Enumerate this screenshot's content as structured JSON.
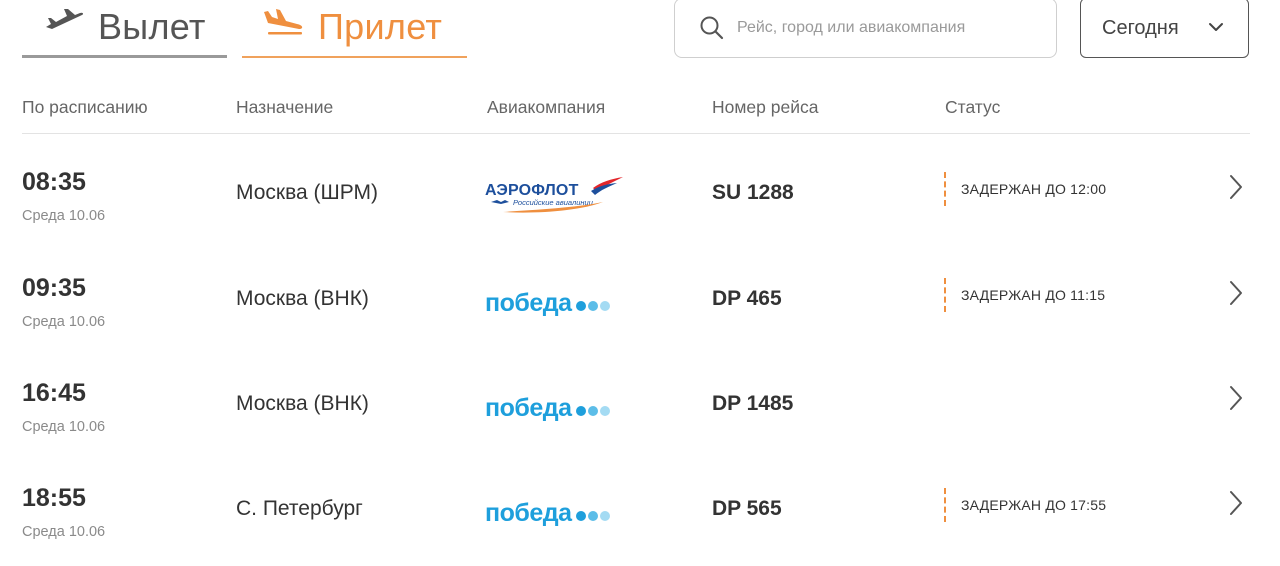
{
  "tabs": [
    {
      "label": "Вылет",
      "icon": "departure-plane-icon",
      "active": false,
      "color": "#555555"
    },
    {
      "label": "Прилет",
      "icon": "arrival-plane-icon",
      "active": true,
      "color": "#ef8f3f"
    }
  ],
  "search": {
    "placeholder": "Рейс, город или авиакомпания",
    "value": "",
    "icon": "search-icon"
  },
  "date_select": {
    "label": "Сегодня",
    "icon": "chevron-down-icon"
  },
  "columns": [
    "По расписанию",
    "Назначение",
    "Авиакомпания",
    "Номер рейса",
    "Статус"
  ],
  "flights": [
    {
      "time": "08:35",
      "date": "Среда 10.06",
      "destination": "Москва (ШРМ)",
      "airline": "aeroflot",
      "logo_text": "АЭРОФЛОТ",
      "logo_subtext": "Российские авиалинии",
      "flight": "SU 1288",
      "status": "ЗАДЕРЖАН ДО 12:00"
    },
    {
      "time": "09:35",
      "date": "Среда 10.06",
      "destination": "Москва (ВНК)",
      "airline": "pobeda",
      "logo_text": "победа",
      "flight": "DP 465",
      "status": "ЗАДЕРЖАН ДО 11:15"
    },
    {
      "time": "16:45",
      "date": "Среда 10.06",
      "destination": "Москва (ВНК)",
      "airline": "pobeda",
      "logo_text": "победа",
      "flight": "DP 1485",
      "status": ""
    },
    {
      "time": "18:55",
      "date": "Среда 10.06",
      "destination": "С. Петербург",
      "airline": "pobeda",
      "logo_text": "победа",
      "flight": "DP 565",
      "status": "ЗАДЕРЖАН ДО 17:55"
    }
  ],
  "colors": {
    "accent": "#ef8f3f",
    "pobeda_blue": "#1e9fdc",
    "aeroflot_blue": "#1d4f9c",
    "aeroflot_red": "#e3262b"
  }
}
